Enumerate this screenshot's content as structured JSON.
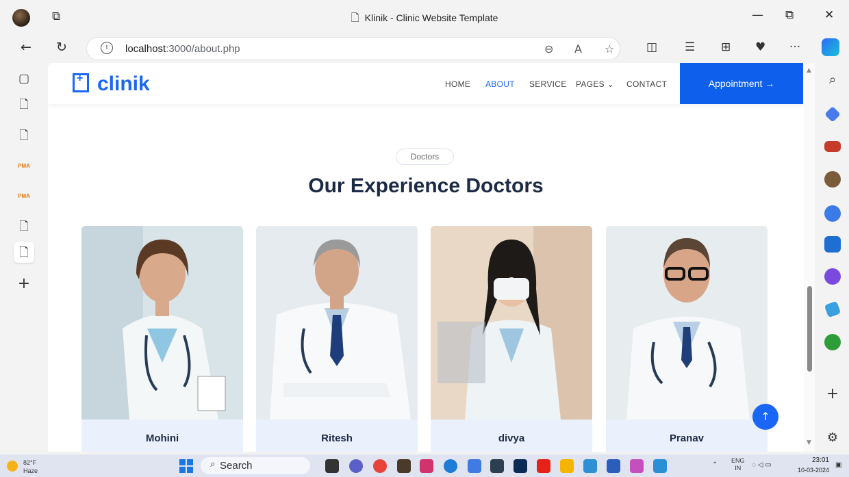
{
  "window": {
    "title": "Klinik - Clinic Website Template",
    "minimize": "—",
    "restore": "⧉",
    "close": "✕"
  },
  "browser": {
    "url_host": "localhost",
    "url_path": ":3000/about.php",
    "info_icon": "i",
    "more_label": "···"
  },
  "vertical_tabs": [
    {
      "icon": "page-icon",
      "glyph": "▢"
    },
    {
      "icon": "page-icon",
      "glyph": "▢"
    },
    {
      "icon": "page-icon",
      "glyph": "▢"
    },
    {
      "icon": "phpmyadmin-icon",
      "label": "PMA"
    },
    {
      "icon": "phpmyadmin-icon",
      "label": "PMA"
    },
    {
      "icon": "page-icon",
      "glyph": "▢"
    },
    {
      "icon": "page-icon",
      "glyph": "▢",
      "active": true
    },
    {
      "icon": "new-tab-icon",
      "glyph": "+"
    }
  ],
  "site": {
    "brand": "clinik",
    "menu": {
      "home": "HOME",
      "about": "ABOUT",
      "service": "SERVICE",
      "pages": "PAGES ⌄",
      "contact": "CONTACT"
    },
    "active_menu": "ABOUT",
    "appointment": "Appointment →",
    "accent": "#1a66f5"
  },
  "section": {
    "pill": "Doctors",
    "title": "Our Experience Doctors"
  },
  "doctors": [
    {
      "name": "Mohini"
    },
    {
      "name": "Ritesh"
    },
    {
      "name": "divya"
    },
    {
      "name": "Pranav"
    }
  ],
  "back_to_top": "↑",
  "taskbar": {
    "temperature": "82°F",
    "condition": "Haze",
    "search": "Search",
    "language": "ENG",
    "region": "IN",
    "time": "23:01",
    "date": "10-03-2024"
  }
}
